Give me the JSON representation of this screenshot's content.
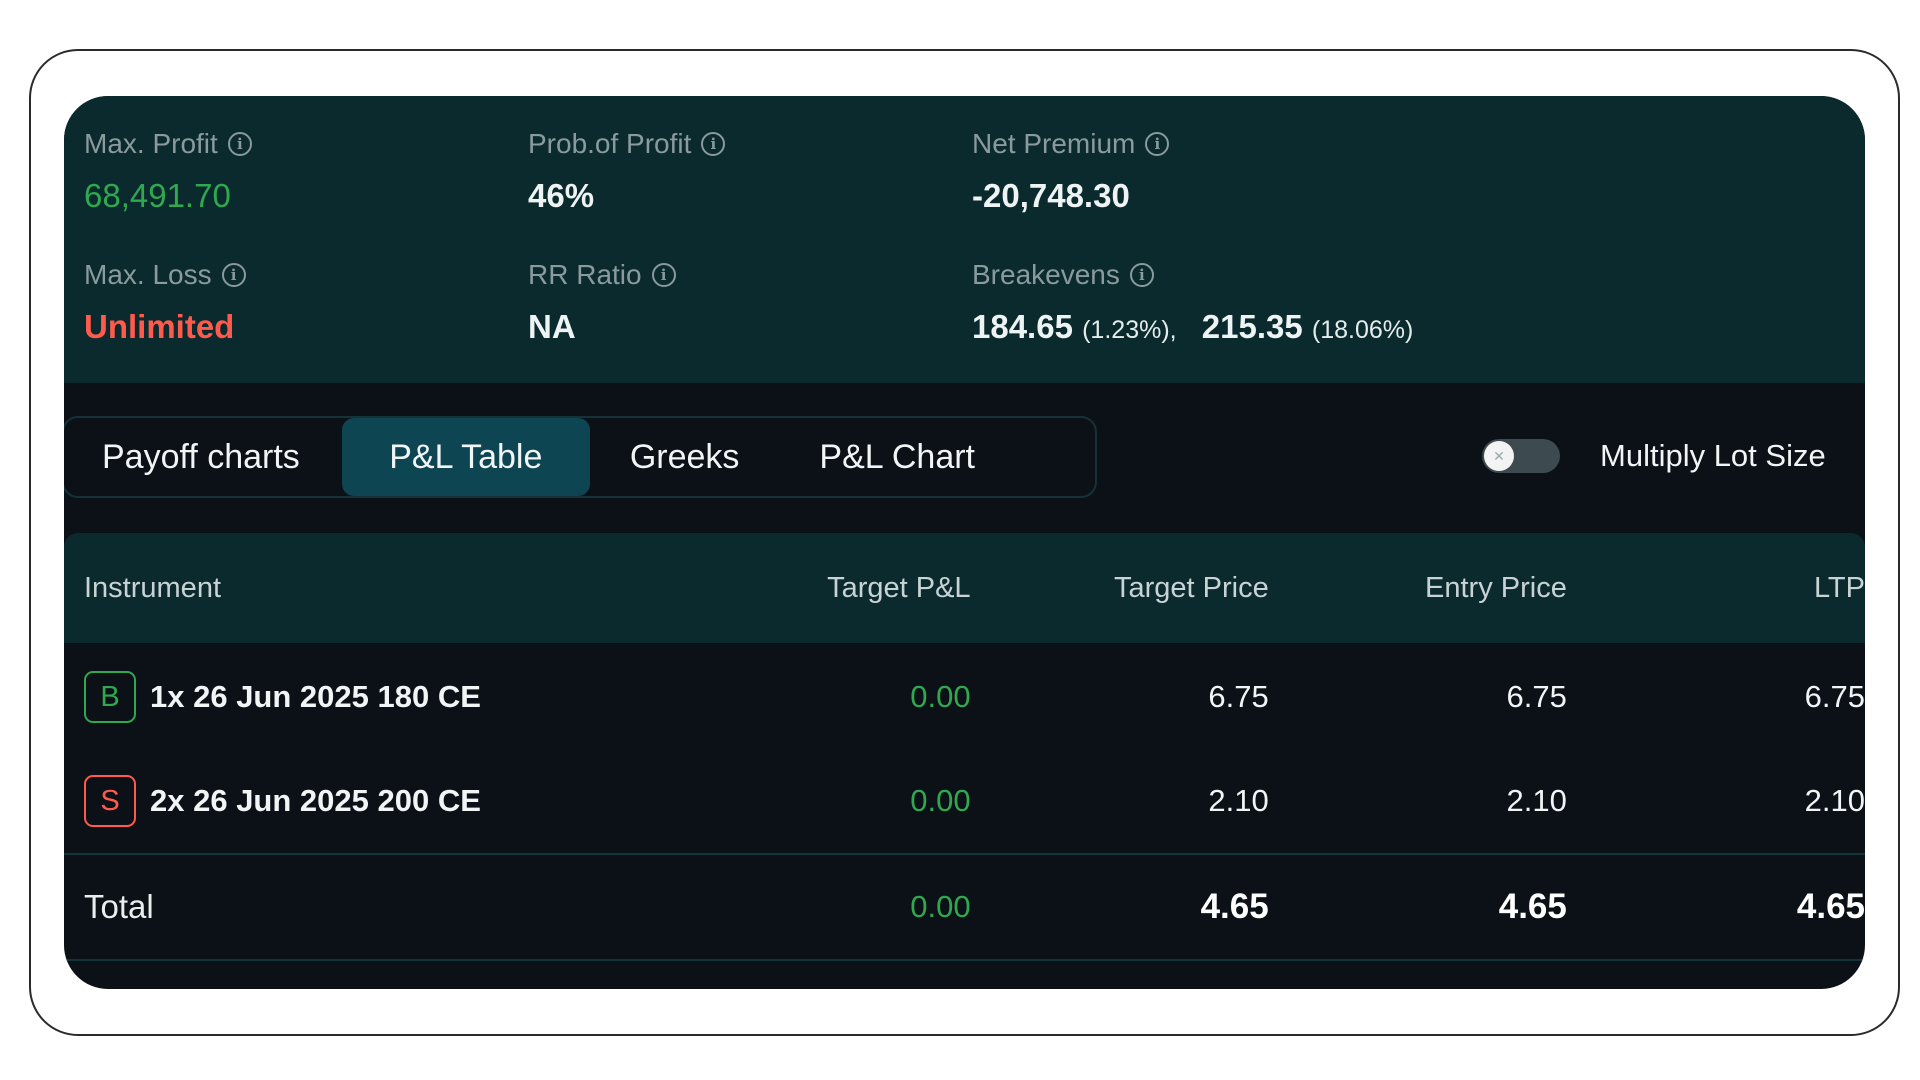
{
  "summary": {
    "max_profit": {
      "label": "Max. Profit",
      "value": "68,491.70"
    },
    "prob_profit": {
      "label": "Prob.of Profit",
      "value": "46%"
    },
    "net_premium": {
      "label": "Net Premium",
      "value": "-20,748.30"
    },
    "max_loss": {
      "label": "Max. Loss",
      "value": "Unlimited"
    },
    "rr_ratio": {
      "label": "RR Ratio",
      "value": "NA"
    },
    "breakevens": {
      "label": "Breakevens",
      "items": [
        {
          "value": "184.65",
          "pct": "(1.23%),"
        },
        {
          "value": "215.35",
          "pct": "(18.06%)"
        }
      ]
    },
    "info_glyph": "i"
  },
  "tabs": [
    {
      "label": "Payoff charts"
    },
    {
      "label": "P&L Table"
    },
    {
      "label": "Greeks"
    },
    {
      "label": "P&L Chart"
    }
  ],
  "active_tab": "P&L Table",
  "multiply_lot_size": {
    "label": "Multiply Lot Size",
    "enabled": false
  },
  "table": {
    "headers": {
      "instrument": "Instrument",
      "target_pl": "Target P&L",
      "target_price": "Target Price",
      "entry_price": "Entry Price",
      "ltp": "LTP"
    },
    "rows": [
      {
        "side": "B",
        "instrument": "1x 26 Jun 2025 180 CE",
        "target_pl": "0.00",
        "target_price": "6.75",
        "entry_price": "6.75",
        "ltp": "6.75"
      },
      {
        "side": "S",
        "instrument": "2x 26 Jun 2025 200 CE",
        "target_pl": "0.00",
        "target_price": "2.10",
        "entry_price": "2.10",
        "ltp": "2.10"
      }
    ],
    "total": {
      "label": "Total",
      "target_pl": "0.00",
      "target_price": "4.65",
      "entry_price": "4.65",
      "ltp": "4.65"
    }
  },
  "colors": {
    "panel_bg": "#0b1116",
    "header_bg": "#0a2a2e",
    "active_tab_bg": "#0e4552",
    "profit_green": "#2fa84f",
    "loss_red": "#ff5a4c"
  }
}
